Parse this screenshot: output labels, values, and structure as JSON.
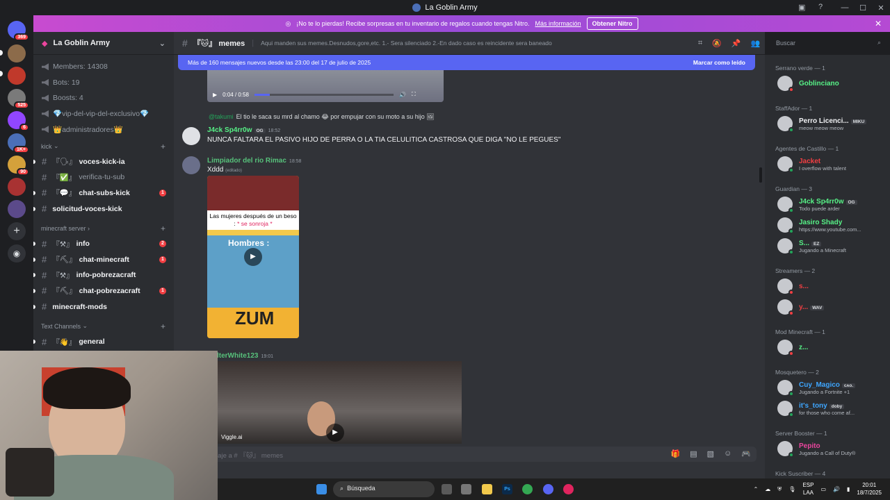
{
  "window": {
    "title": "La Goblin Army"
  },
  "guild_badges": [
    "369",
    "525",
    "6",
    "1K+",
    "90"
  ],
  "nitro": {
    "text": "¡No te lo pierdas! Recibe sorpresas en tu inventario de regalos cuando tengas Nitro.",
    "link": "Más información",
    "button": "Obtener Nitro"
  },
  "server": {
    "name": "La Goblin Army",
    "info": [
      "Members: 14308",
      "Bots: 19",
      "Boosts: 4",
      "💎vip-del-vip-del-exclusivo💎",
      "👑administradores👑"
    ],
    "categories": {
      "kick": "kick",
      "minecraft": "minecraft server",
      "text": "Text Channels"
    },
    "kick_channels": [
      {
        "emoji": "『🗣』",
        "name": "voces-kick-ia",
        "badge": ""
      },
      {
        "emoji": "『✅』",
        "name": "verifica-tu-sub",
        "badge": ""
      },
      {
        "emoji": "『💬』",
        "name": "chat-subs-kick",
        "badge": "1"
      },
      {
        "emoji": "",
        "name": "solicitud-voces-kick",
        "badge": ""
      }
    ],
    "mc_channels": [
      {
        "emoji": "『⚒』",
        "name": "info",
        "badge": "2"
      },
      {
        "emoji": "『⛏』",
        "name": "chat-minecraft",
        "badge": "1"
      },
      {
        "emoji": "『⚒』",
        "name": "info-pobrezacraft",
        "badge": ""
      },
      {
        "emoji": "『⛏』",
        "name": "chat-pobrezacraft",
        "badge": "1"
      },
      {
        "emoji": "",
        "name": "minecraft-mods",
        "badge": ""
      }
    ],
    "text_channels": [
      {
        "emoji": "『👋』",
        "name": "general"
      }
    ]
  },
  "channel": {
    "name": "『🐱』 memes",
    "topic": "Aqui manden sus memes.Desnudos,gore,etc. 1.- Sera silenciado 2.-En dado caso es reincidente sera baneado",
    "search_placeholder": "Buscar"
  },
  "newbar": {
    "text": "Más de 160 mensajes nuevos desde las 23:00 del 17 de julio de 2025",
    "mark": "Marcar como leído"
  },
  "video1": {
    "time": "0:04 / 0:58"
  },
  "messages": {
    "reply": {
      "user": "@takumi",
      "text": "El tio le saca su mrd al chamo 😂 por empujar con su moto a su hijo 🖼"
    },
    "m1": {
      "user": "J4ck Sp4rr0w",
      "tag": "OG",
      "time": "18:52",
      "text": "NUNCA FALTARA EL PASIVO HIJO DE PERRA O LA TIA CELULITICA CASTROSA QUE DIGA \"NO LE PEGUES\""
    },
    "m2": {
      "user": "Limpiador del rio Rimac",
      "time": "18:58",
      "text": "Xddd",
      "edited": "(editado)"
    },
    "gif": {
      "caption": "Las mujeres después de un beso :",
      "caption_pink": "* se sonroja *",
      "game": "Hombres :",
      "bottom": "ZUM"
    },
    "m3": {
      "user": "lterWhite123",
      "time": "19:01"
    },
    "video2": {
      "watermark": "Viggle.ai"
    }
  },
  "composer": {
    "placeholder": "viar mensaje a # 『🐱』 memes"
  },
  "member_groups": [
    {
      "label": "Serrano verde — 1",
      "members": [
        {
          "name": "Goblinciano",
          "color": "#57f287",
          "sub": "",
          "tag": ""
        }
      ]
    },
    {
      "label": "StaffAdor — 1",
      "members": [
        {
          "name": "Perro Licenci...",
          "color": "#f2f3f5",
          "sub": "meow meow meow",
          "tag": "MIKU"
        }
      ]
    },
    {
      "label": "Agentes de Castillo — 1",
      "members": [
        {
          "name": "Jacket",
          "color": "#f23f43",
          "sub": "I overflow with talent",
          "tag": ""
        }
      ]
    },
    {
      "label": "Guardian — 3",
      "members": [
        {
          "name": "J4ck Sp4rr0w",
          "color": "#57f287",
          "sub": "Todo puede arder",
          "tag": "OG"
        },
        {
          "name": "Jasiro Shady",
          "color": "#57f287",
          "sub": "https://www.youtube.com...",
          "tag": ""
        },
        {
          "name": "S...",
          "color": "#57f287",
          "sub": "Jugando a Minecraft",
          "tag": "EZ"
        }
      ]
    },
    {
      "label": "Streamers — 2",
      "members": [
        {
          "name": "s...",
          "color": "#f23f43",
          "sub": "",
          "tag": ""
        },
        {
          "name": "y...",
          "color": "#f23f43",
          "sub": "",
          "tag": "WAV"
        }
      ]
    },
    {
      "label": "Mod Minecraft — 1",
      "members": [
        {
          "name": "z...",
          "color": "#57f287",
          "sub": "",
          "tag": ""
        }
      ]
    },
    {
      "label": "Mosquetero — 2",
      "members": [
        {
          "name": "Cuy_Magico",
          "color": "#3ea6ff",
          "sub": "Jugando a Fortnite +1",
          "tag": "ᴄᴀᴏ."
        },
        {
          "name": "it's_tony",
          "color": "#3ea6ff",
          "sub": "for those who come af...",
          "tag": "doby"
        }
      ]
    },
    {
      "label": "Server Booster — 1",
      "members": [
        {
          "name": "Pepito",
          "color": "#eb459e",
          "sub": "Jugando a Call of Duty®",
          "tag": ""
        }
      ]
    },
    {
      "label": "Kick Suscriber — 4",
      "members": []
    }
  ],
  "taskbar": {
    "search": "Búsqueda",
    "lang": "ESP",
    "lang2": "LAA",
    "time": "20:01",
    "date": "18/7/2025"
  }
}
